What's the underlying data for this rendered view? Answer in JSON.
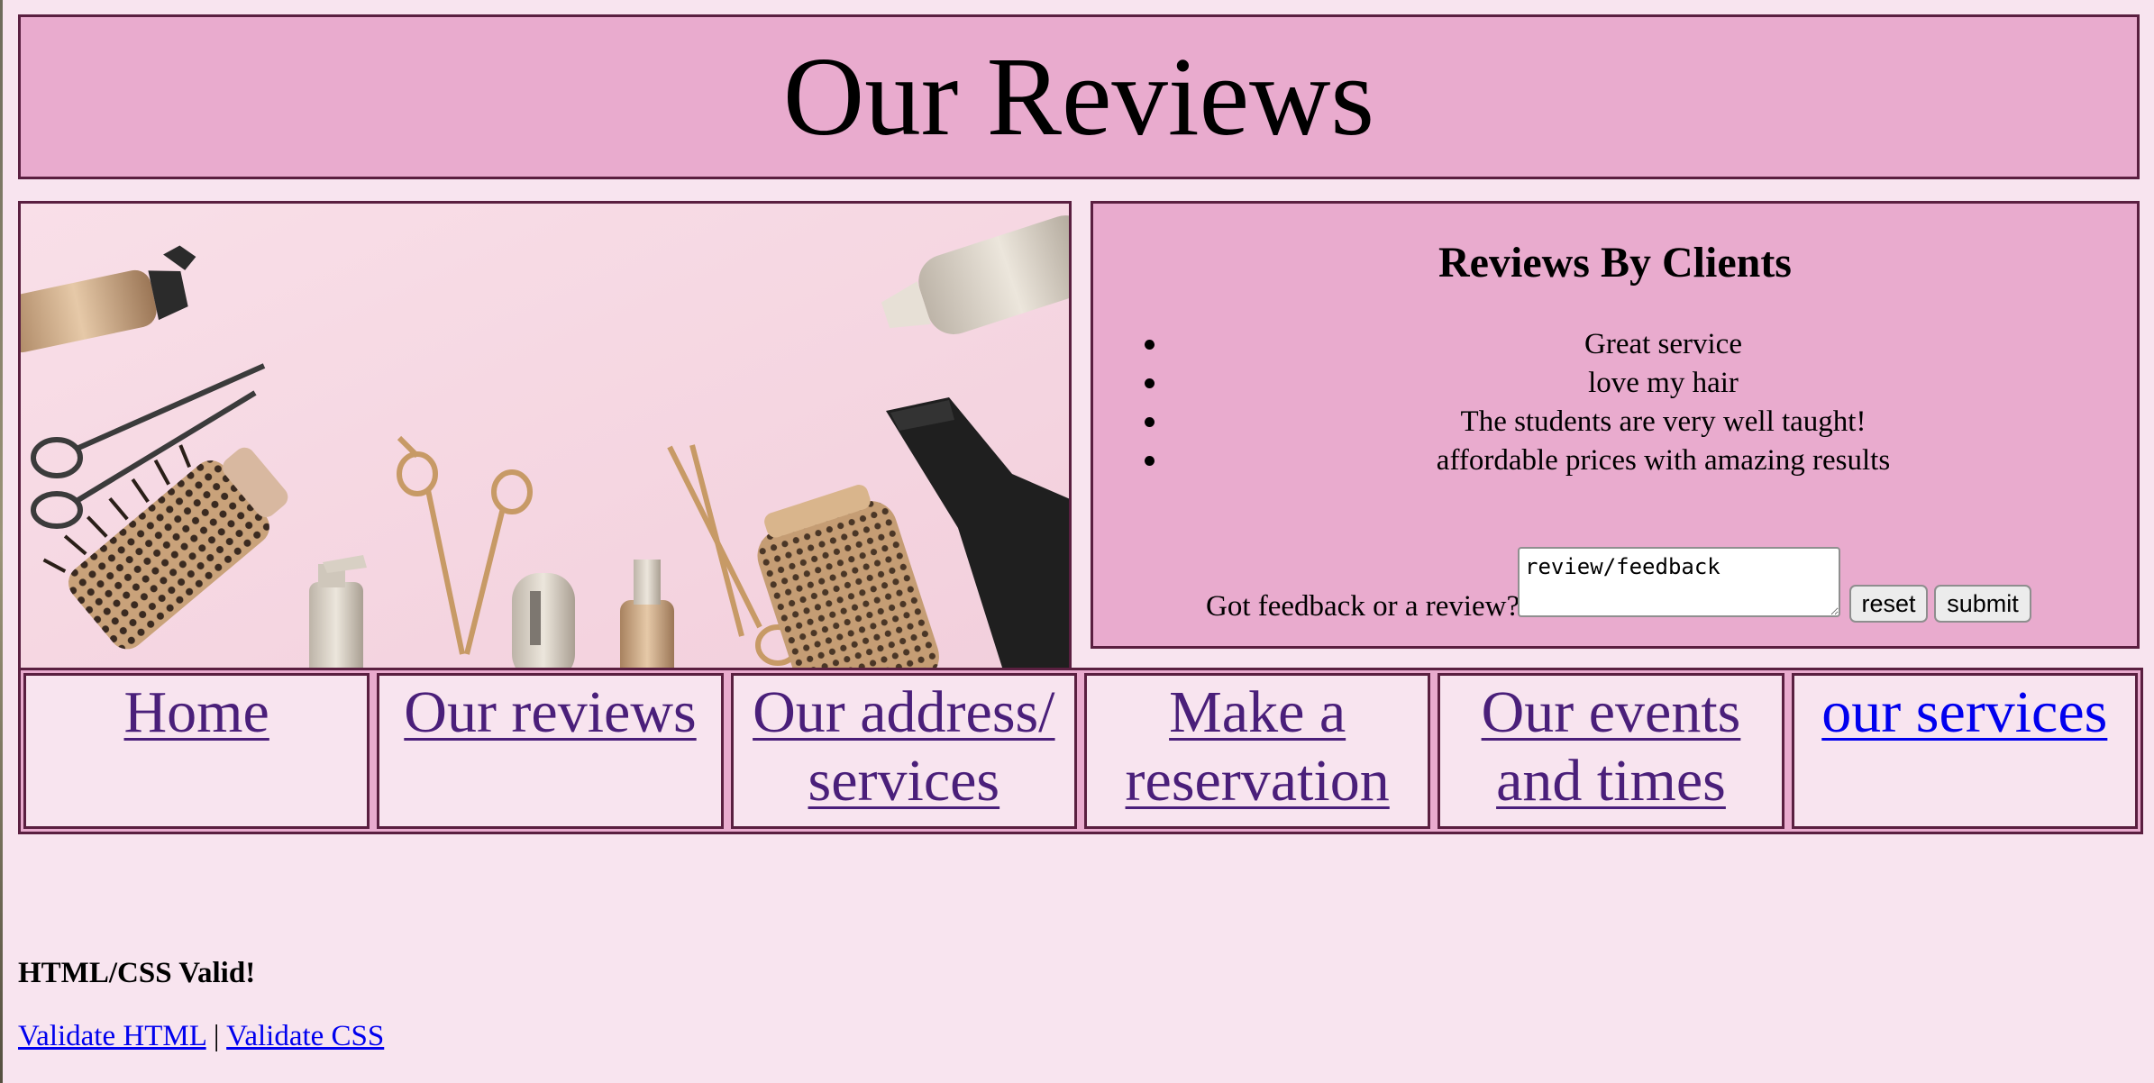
{
  "header": {
    "title": "Our Reviews"
  },
  "reviews": {
    "heading": "Reviews By Clients",
    "items": [
      "Great service",
      "love my hair",
      "The students are very well taught!",
      "affordable prices with amazing results"
    ]
  },
  "feedback": {
    "label": "Got feedback or a review?",
    "textarea_value": "review/feedback",
    "reset_label": "reset",
    "submit_label": "submit"
  },
  "nav": {
    "items": [
      {
        "label": "Home"
      },
      {
        "label": "Our reviews"
      },
      {
        "label": "Our address/ services"
      },
      {
        "label": "Make a reservation"
      },
      {
        "label": "Our events and times"
      },
      {
        "label": "our services"
      }
    ]
  },
  "footer": {
    "valid_text": "HTML/CSS Valid!",
    "validate_html": "Validate HTML",
    "separator": "|",
    "validate_css": "Validate CSS"
  },
  "colors": {
    "page_background": "#f8e4ef",
    "panel_pink": "#e9abce",
    "border_plum": "#5a1f40",
    "visited_link": "#4a1f7a",
    "link_blue": "#0000ee"
  }
}
